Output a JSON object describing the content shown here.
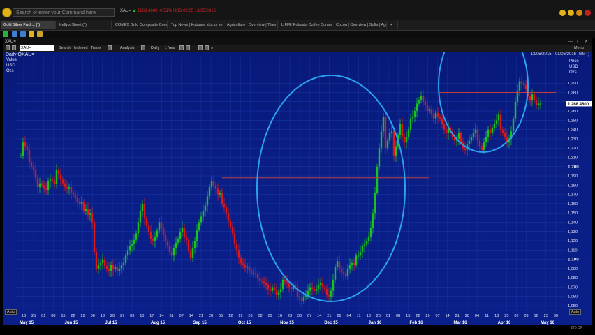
{
  "topbar": {
    "command_placeholder": "Search or enter your Command here",
    "ticker_symbol": "XAU=",
    "ticker_rest": "1268.4600   -0.51%   USD   02:35   13/05/2016"
  },
  "tabs": [
    {
      "label": "Gold Silver Fwd ... (*)",
      "active": true
    },
    {
      "label": "Kelly's Sheet (*)",
      "active": false
    },
    {
      "label": "COMEX Gold Composite Commodi...",
      "active": false
    },
    {
      "label": "Top News | Kobuate stocks se...",
      "active": false
    },
    {
      "label": "Agriculture | Overview | Them...",
      "active": false
    },
    {
      "label": "LIFFE Robusta Coffee Commodi...",
      "active": false
    },
    {
      "label": "Cocoa | Overview | Softs | Agri...",
      "active": false
    },
    {
      "label": "+",
      "active": false
    }
  ],
  "window": {
    "title": "XAU=",
    "controls": "— ▢ ✕"
  },
  "chart_toolbar": {
    "symbol": "XAU=",
    "buttons": [
      "Search",
      "Indexed",
      "Trade",
      "Analysis",
      "Daily",
      "1 Year",
      "≡"
    ],
    "menu_label": "Menu"
  },
  "chart_header": {
    "title": "Daily QXAU=",
    "left_axis_label": [
      "Value",
      "USD",
      "Ozs"
    ],
    "right_axis_label": [
      "Price",
      "USD",
      "Ozs"
    ],
    "date_range": "13/05/2015 - 01/06/2016 (GMT)",
    "auto_left": "Auto",
    "auto_right": "Auto",
    "last_price": "1,268.4600",
    "scroll_label": "275 OF"
  },
  "chart_data": {
    "type": "candlestick",
    "title": "Daily QXAU=",
    "ylabel": "Price USD Ozs",
    "ylim": [
      1044,
      1318
    ],
    "y_ticks": [
      1050,
      1060,
      1070,
      1080,
      1090,
      1100,
      1110,
      1120,
      1130,
      1140,
      1150,
      1160,
      1170,
      1180,
      1190,
      1200,
      1210,
      1220,
      1230,
      1240,
      1250,
      1260,
      1270,
      1280,
      1290
    ],
    "y_bold_ticks": [
      1100,
      1200
    ],
    "x_ticks": [
      "18",
      "25",
      "01",
      "08",
      "15",
      "22",
      "29",
      "06",
      "13",
      "20",
      "27",
      "03",
      "10",
      "17",
      "24",
      "31",
      "07",
      "14",
      "21",
      "28",
      "05",
      "12",
      "19",
      "26",
      "02",
      "09",
      "16",
      "23",
      "30",
      "07",
      "14",
      "21",
      "28",
      "04",
      "11",
      "18",
      "25",
      "01",
      "08",
      "15",
      "22",
      "29",
      "07",
      "14",
      "21",
      "28",
      "04",
      "11",
      "18",
      "25",
      "02",
      "09",
      "16",
      "23",
      "30"
    ],
    "month_labels": [
      "May 15",
      "Jun 15",
      "Jul 15",
      "Aug 15",
      "Sep 15",
      "Oct 15",
      "Nov 15",
      "Dec 15",
      "Jan 16",
      "Feb 16",
      "Mar 16",
      "Apr 16",
      "May 16"
    ],
    "close_series": [
      1212,
      1226,
      1222,
      1218,
      1205,
      1200,
      1196,
      1188,
      1178,
      1182,
      1180,
      1176,
      1175,
      1184,
      1186,
      1185,
      1181,
      1196,
      1192,
      1186,
      1182,
      1178,
      1176,
      1178,
      1172,
      1170,
      1166,
      1162,
      1160,
      1162,
      1152,
      1154,
      1148,
      1150,
      1140,
      1108,
      1090,
      1094,
      1096,
      1100,
      1093,
      1090,
      1087,
      1094,
      1089,
      1092,
      1087,
      1090,
      1094,
      1096,
      1104,
      1110,
      1114,
      1117,
      1121,
      1128,
      1140,
      1152,
      1160,
      1144,
      1136,
      1130,
      1122,
      1120,
      1124,
      1131,
      1140,
      1134,
      1126,
      1119,
      1114,
      1108,
      1104,
      1112,
      1118,
      1122,
      1129,
      1134,
      1124,
      1121,
      1110,
      1102,
      1112,
      1120,
      1132,
      1140,
      1146,
      1152,
      1158,
      1168,
      1178,
      1184,
      1180,
      1176,
      1170,
      1172,
      1160,
      1156,
      1150,
      1142,
      1135,
      1128,
      1117,
      1110,
      1102,
      1096,
      1094,
      1091,
      1092,
      1088,
      1085,
      1085,
      1084,
      1080,
      1077,
      1076,
      1074,
      1072,
      1068,
      1066,
      1070,
      1067,
      1062,
      1064,
      1068,
      1078,
      1076,
      1074,
      1070,
      1068,
      1072,
      1070,
      1060,
      1058,
      1055,
      1060,
      1062,
      1066,
      1070,
      1068,
      1066,
      1068,
      1072,
      1075,
      1070,
      1068,
      1062,
      1060,
      1066,
      1078,
      1092,
      1098,
      1090,
      1086,
      1084,
      1082,
      1090,
      1094,
      1096,
      1094,
      1104,
      1104,
      1108,
      1114,
      1116,
      1120,
      1124,
      1134,
      1150,
      1172,
      1200,
      1220,
      1238,
      1254,
      1220,
      1228,
      1236,
      1238,
      1212,
      1222,
      1234,
      1246,
      1232,
      1226,
      1232,
      1240,
      1252,
      1254,
      1260,
      1268,
      1272,
      1276,
      1270,
      1266,
      1260,
      1262,
      1256,
      1252,
      1258,
      1254,
      1252,
      1246,
      1240,
      1236,
      1242,
      1236,
      1232,
      1228,
      1230,
      1236,
      1226,
      1220,
      1218,
      1224,
      1228,
      1232,
      1236,
      1240,
      1228,
      1222,
      1218,
      1226,
      1232,
      1240,
      1236,
      1242,
      1246,
      1250,
      1256,
      1240,
      1236,
      1232,
      1226,
      1230,
      1238,
      1252,
      1270,
      1282,
      1292,
      1290,
      1288,
      1284,
      1276,
      1272,
      1278,
      1272,
      1266,
      1268,
      1268
    ],
    "resistance_lines": [
      {
        "from_label": "Oct 15",
        "to_label": "Feb 16",
        "value": 1188
      },
      {
        "from_label": "Mar 16",
        "to_label": "May 16",
        "value": 1280
      }
    ],
    "annotations": [
      "ellipse around Nov 15 - Jan 16 lows",
      "ellipse around Mar 16 - May 16 highs"
    ],
    "colors": {
      "background": "#0a1e86",
      "up": "#19c21c",
      "down": "#e01717",
      "grid": "#1b3aa8",
      "ellipse": "#2aa2f0",
      "resistance": "#c43b3b"
    },
    "grid": true
  }
}
